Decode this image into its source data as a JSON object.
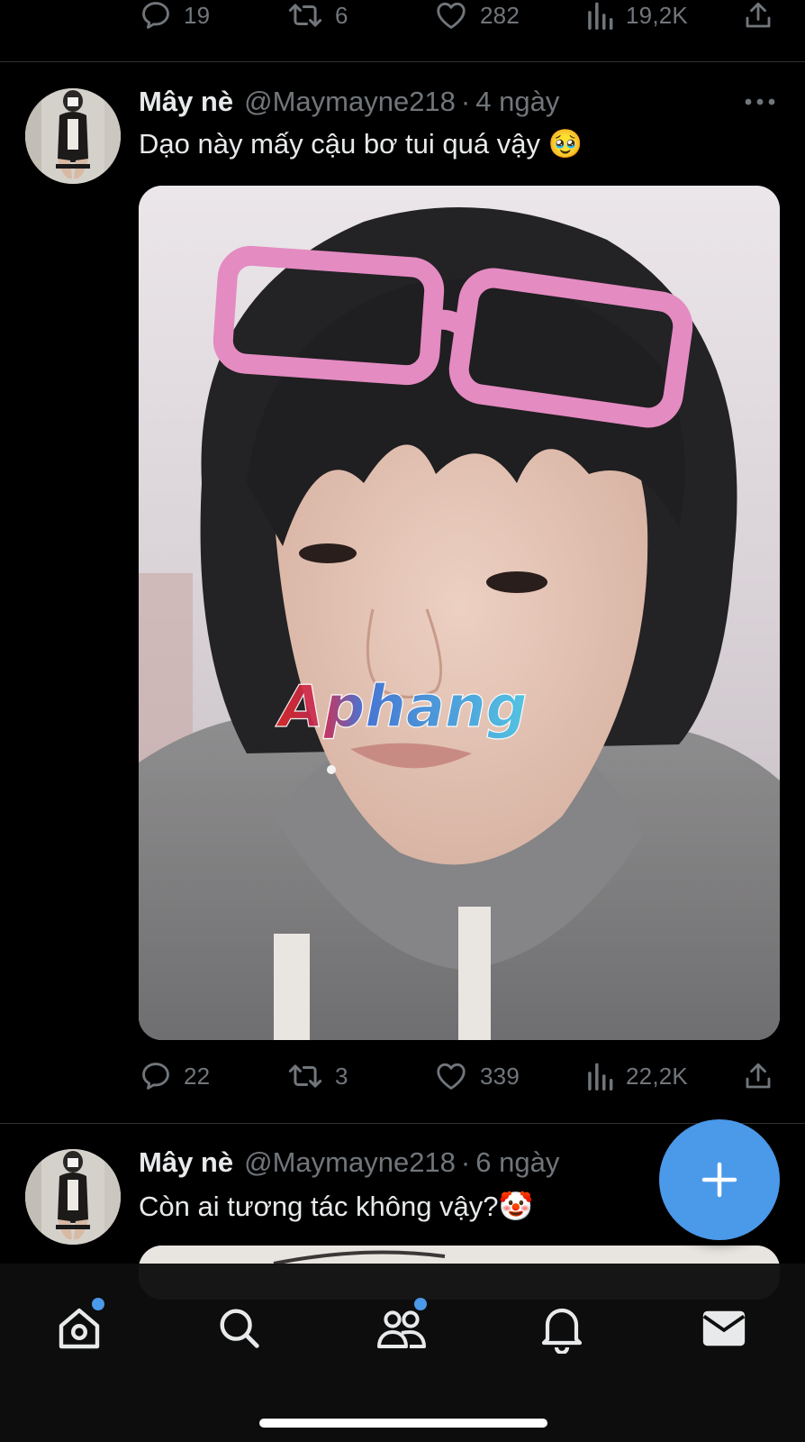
{
  "prev_tweet": {
    "replies": "19",
    "retweets": "6",
    "likes": "282",
    "views": "19,2K"
  },
  "tweets": [
    {
      "name": "Mây nè",
      "handle": "@Maymayne218",
      "separator": "·",
      "time": "4 ngày",
      "text": "Dạo này mấy cậu bơ tui quá vậy 🥹",
      "watermark": "Aphang",
      "replies": "22",
      "retweets": "3",
      "likes": "339",
      "views": "22,2K"
    },
    {
      "name": "Mây nè",
      "handle": "@Maymayne218",
      "separator": "·",
      "time": "6 ngày",
      "text": "Còn ai tương tác không vậy?🤡"
    }
  ],
  "icons": {
    "reply": "reply-icon",
    "retweet": "retweet-icon",
    "like": "heart-icon",
    "views": "views-icon",
    "share": "share-icon",
    "more": "more-icon",
    "compose": "compose-plus-icon",
    "nav": [
      "home-icon",
      "search-icon",
      "communities-icon",
      "notifications-icon",
      "messages-icon"
    ]
  },
  "colors": {
    "background": "#000000",
    "text_primary": "#e7e9ea",
    "text_secondary": "#71767b",
    "accent": "#4b99e9",
    "divider": "#2f3336"
  }
}
